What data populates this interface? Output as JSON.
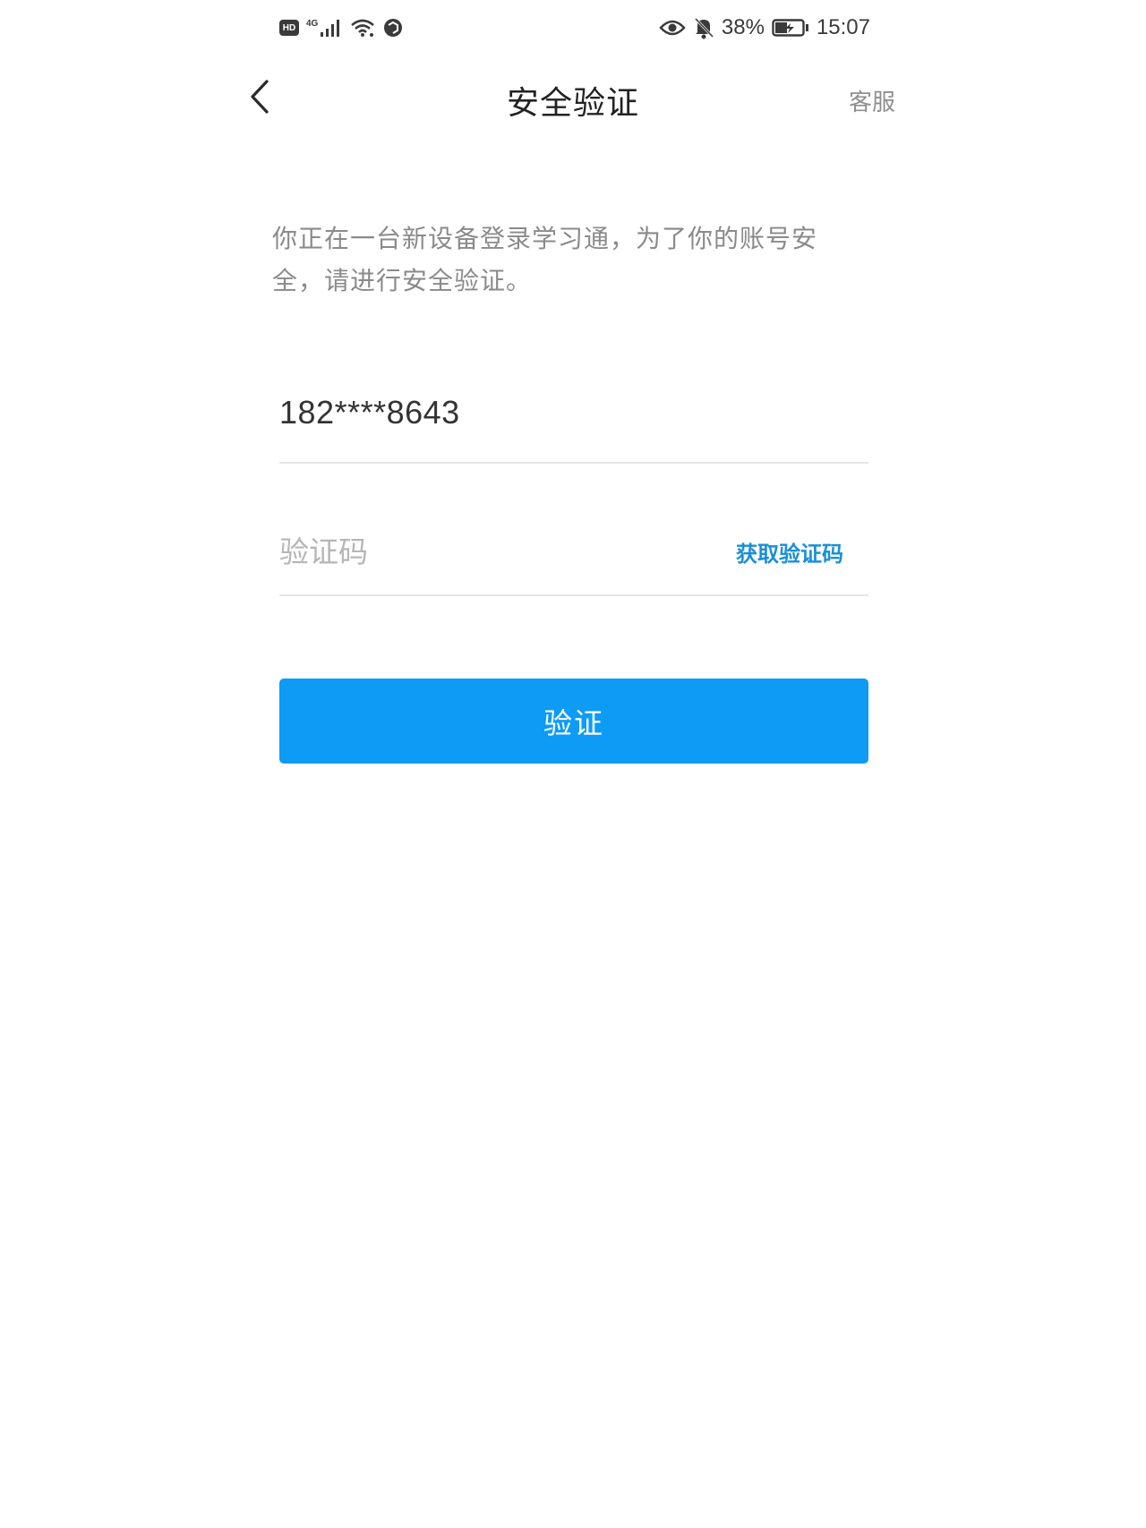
{
  "status_bar": {
    "hd_label": "HD",
    "network_type": "4G",
    "battery_percent": "38%",
    "time": "15:07",
    "icons": [
      "hd-icon",
      "signal-icon",
      "wifi-icon",
      "vpn-icon",
      "eye-icon",
      "bell-off-icon",
      "battery-charging-icon"
    ]
  },
  "nav": {
    "title": "安全验证",
    "service_label": "客服",
    "back_icon": "chevron-left-icon"
  },
  "description": "你正在一台新设备登录学习通，为了你的账号安全，请进行安全验证。",
  "form": {
    "phone": "182****8643",
    "code_placeholder": "验证码",
    "code_value": "",
    "get_code_label": "获取验证码"
  },
  "verify_button": {
    "label": "验证"
  },
  "colors": {
    "primary": "#0d9bf5",
    "link": "#1a8fd8",
    "title": "#222222",
    "muted_text": "#8a8a8a",
    "divider": "#e6e6e6"
  }
}
